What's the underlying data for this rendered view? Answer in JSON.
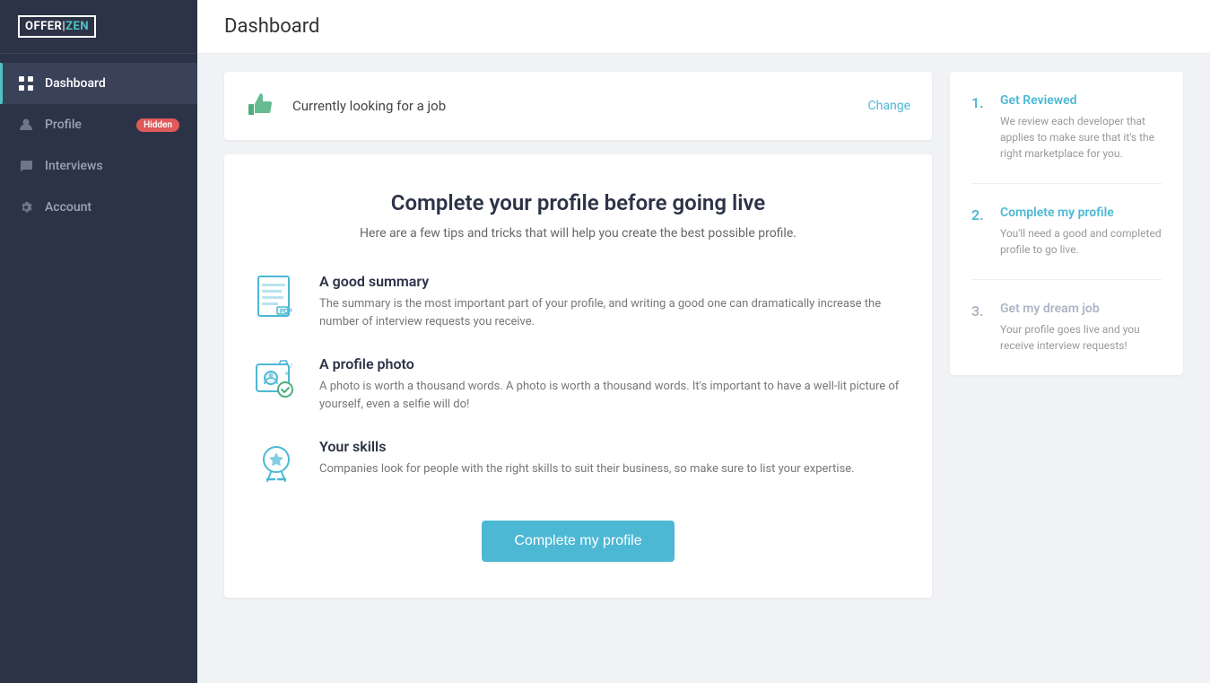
{
  "logo": {
    "offer": "OFFER",
    "zen": "ZEN",
    "separator": "|"
  },
  "sidebar": {
    "items": [
      {
        "id": "dashboard",
        "label": "Dashboard",
        "icon": "grid-icon",
        "active": true,
        "badge": null
      },
      {
        "id": "profile",
        "label": "Profile",
        "icon": "user-icon",
        "active": false,
        "badge": "Hidden"
      },
      {
        "id": "interviews",
        "label": "Interviews",
        "icon": "chat-icon",
        "active": false,
        "badge": null
      },
      {
        "id": "account",
        "label": "Account",
        "icon": "gear-icon",
        "active": false,
        "badge": null
      }
    ]
  },
  "header": {
    "title": "Dashboard"
  },
  "status_banner": {
    "status_text": "Currently looking for a job",
    "change_label": "Change"
  },
  "profile_card": {
    "title": "Complete your profile before going live",
    "subtitle": "Here are a few tips and tricks that will help you create the best possible profile.",
    "tips": [
      {
        "id": "summary",
        "title": "A good summary",
        "description": "The summary is the most important part of your profile, and writing a good one can dramatically increase the number of interview requests you receive."
      },
      {
        "id": "photo",
        "title": "A profile photo",
        "description": "A photo is worth a thousand words. A photo is worth a thousand words. It's important to have a well-lit picture of yourself, even a selfie will do!"
      },
      {
        "id": "skills",
        "title": "Your skills",
        "description": "Companies look for people with the right skills to suit their business, so make sure to list your expertise."
      }
    ],
    "complete_button_label": "Complete my profile"
  },
  "steps": {
    "items": [
      {
        "number": "1.",
        "title": "Get Reviewed",
        "description": "We review each developer that applies to make sure that it's the right marketplace for you.",
        "active": true
      },
      {
        "number": "2.",
        "title": "Complete my profile",
        "description": "You'll need a good and completed profile to go live.",
        "active": true
      },
      {
        "number": "3.",
        "title": "Get my dream job",
        "description": "Your profile goes live and you receive interview requests!",
        "active": false
      }
    ]
  }
}
